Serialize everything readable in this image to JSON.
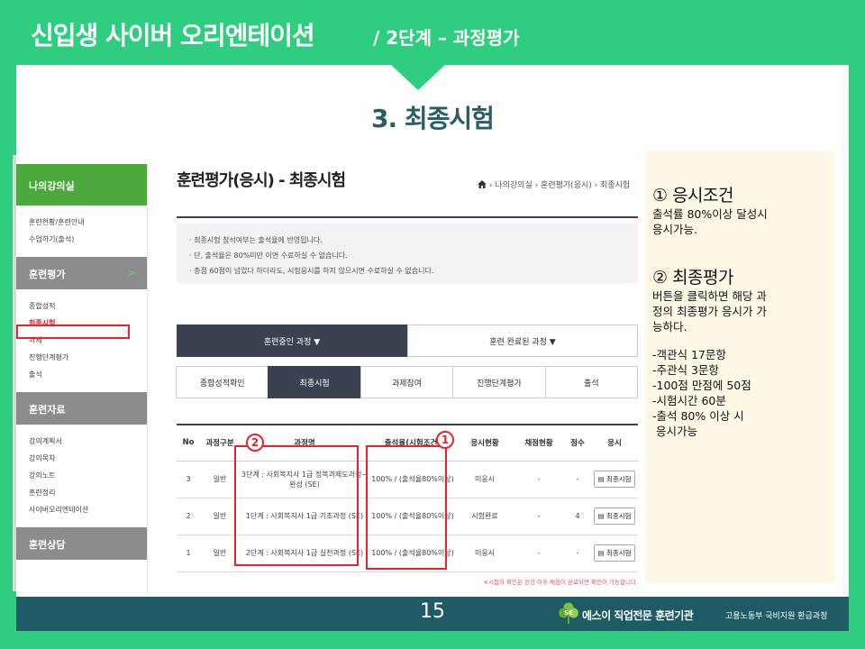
{
  "slide": {
    "title": "신입생 사이버 오리엔테이션",
    "subtitle": "/ 2단계 – 과정평가",
    "section_title": "3. 최종시험",
    "page_number": "15",
    "footer_brand": "에스이 직업전문 훈련기관",
    "footer_sub": "고용노동부 국비지원 환급과정",
    "logo_text": "SE",
    "colors": {
      "green": "#2fcd7f",
      "teal": "#1e5b65",
      "highlight_red": "#e8232f"
    }
  },
  "sidebar": {
    "header": "나의강의실",
    "top_items": [
      "훈련현황/훈련안내",
      "수업하기(출석)"
    ],
    "section1": {
      "label": "훈련평가",
      "arrow": ">"
    },
    "section1_items": [
      "종합성적",
      "최종시험",
      "과제",
      "진행단계평가",
      "출석"
    ],
    "active_item": "최종시험",
    "section2": {
      "label": "훈련자료"
    },
    "section2_items": [
      "강의계획서",
      "강의목차",
      "강의노트",
      "훈련정리",
      "사이버오리엔테이션"
    ],
    "section3": {
      "label": "훈련상담"
    }
  },
  "content": {
    "title": "훈련평가(응시) - 최종시험",
    "breadcrumb": "› 나의강의실 › 훈련평가(응시) › 최종시험",
    "notices": [
      "· 최종시험 참석여부는 출석율에 반영됩니다.",
      "· 단, 출석율은 80%미만 이면 수료하실 수 없습니다.",
      "· 총점 60점이 넘었다 하더라도, 시험응시를 하지 않으시면 수료하실 수 없습니다."
    ],
    "progress_tabs": [
      "훈련중인 과정 ▼",
      "훈련 완료된 과정 ▼"
    ],
    "sub_tabs": [
      "종합성적확인",
      "최종시험",
      "과제참여",
      "진행단계평가",
      "출석"
    ],
    "table": {
      "headers": [
        "No",
        "과정구분",
        "과정명",
        "출석율(시험조건)",
        "응시현황",
        "채점현황",
        "점수",
        "응시"
      ],
      "rows": [
        {
          "no": "3",
          "type": "일반",
          "name": "3단계 : 사회복지사 1급 정복과제도과정~완성 (SE)",
          "attendance": "100% / (출석율80%이상)",
          "status": "미응시",
          "grading": "-",
          "score": "-",
          "action": "최종시험"
        },
        {
          "no": "2",
          "type": "일반",
          "name": "1단계 : 사회복지사 1급 기초과정 (SE)",
          "attendance": "100% / (출석율80%이상)",
          "status": "시험완료",
          "grading": "-",
          "score": "4",
          "action": "최종시험"
        },
        {
          "no": "1",
          "type": "일반",
          "name": "2단계 : 사회복지사 1급 실천과정 (SE)",
          "attendance": "100% / (출석율80%이상)",
          "status": "미응시",
          "grading": "-",
          "score": "-",
          "action": "최종시험"
        }
      ]
    },
    "footnote": "※시험지 확인은 응강 이후 채점이 완료되면 확인이 가능합니다."
  },
  "annotations": {
    "marker1": "1",
    "marker2": "2"
  },
  "info_panel": {
    "cond_heading": "① 응시조건",
    "cond_text": [
      "출석률 80%이상 달성시",
      "응시가능."
    ],
    "final_heading": "② 최종평가",
    "final_text": [
      "버튼을 클릭하면 해당 과",
      "정의 최종평가 응시가 가",
      "능하다."
    ],
    "details": [
      "-객관식 17문항",
      "-주관식  3문항",
      "-100점 만점에 50점",
      "-시험시간 60분",
      "-출석 80% 이상 시",
      " 응시가능"
    ]
  }
}
